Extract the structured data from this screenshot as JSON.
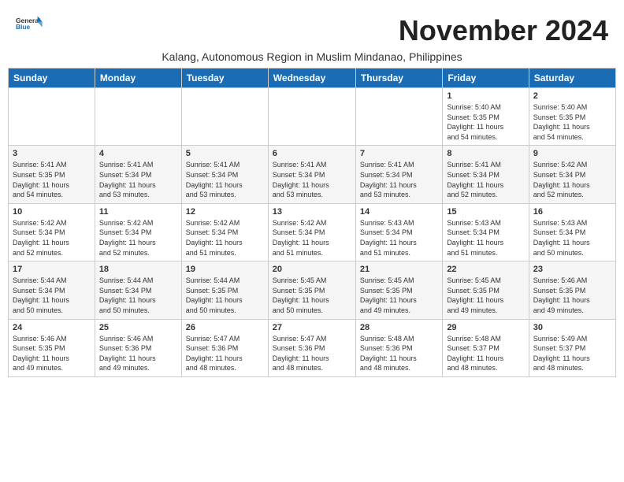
{
  "header": {
    "logo_general": "General",
    "logo_blue": "Blue",
    "month_year": "November 2024",
    "subtitle": "Kalang, Autonomous Region in Muslim Mindanao, Philippines"
  },
  "days_of_week": [
    "Sunday",
    "Monday",
    "Tuesday",
    "Wednesday",
    "Thursday",
    "Friday",
    "Saturday"
  ],
  "weeks": [
    [
      {
        "day": "",
        "info": ""
      },
      {
        "day": "",
        "info": ""
      },
      {
        "day": "",
        "info": ""
      },
      {
        "day": "",
        "info": ""
      },
      {
        "day": "",
        "info": ""
      },
      {
        "day": "1",
        "info": "Sunrise: 5:40 AM\nSunset: 5:35 PM\nDaylight: 11 hours\nand 54 minutes."
      },
      {
        "day": "2",
        "info": "Sunrise: 5:40 AM\nSunset: 5:35 PM\nDaylight: 11 hours\nand 54 minutes."
      }
    ],
    [
      {
        "day": "3",
        "info": "Sunrise: 5:41 AM\nSunset: 5:35 PM\nDaylight: 11 hours\nand 54 minutes."
      },
      {
        "day": "4",
        "info": "Sunrise: 5:41 AM\nSunset: 5:34 PM\nDaylight: 11 hours\nand 53 minutes."
      },
      {
        "day": "5",
        "info": "Sunrise: 5:41 AM\nSunset: 5:34 PM\nDaylight: 11 hours\nand 53 minutes."
      },
      {
        "day": "6",
        "info": "Sunrise: 5:41 AM\nSunset: 5:34 PM\nDaylight: 11 hours\nand 53 minutes."
      },
      {
        "day": "7",
        "info": "Sunrise: 5:41 AM\nSunset: 5:34 PM\nDaylight: 11 hours\nand 53 minutes."
      },
      {
        "day": "8",
        "info": "Sunrise: 5:41 AM\nSunset: 5:34 PM\nDaylight: 11 hours\nand 52 minutes."
      },
      {
        "day": "9",
        "info": "Sunrise: 5:42 AM\nSunset: 5:34 PM\nDaylight: 11 hours\nand 52 minutes."
      }
    ],
    [
      {
        "day": "10",
        "info": "Sunrise: 5:42 AM\nSunset: 5:34 PM\nDaylight: 11 hours\nand 52 minutes."
      },
      {
        "day": "11",
        "info": "Sunrise: 5:42 AM\nSunset: 5:34 PM\nDaylight: 11 hours\nand 52 minutes."
      },
      {
        "day": "12",
        "info": "Sunrise: 5:42 AM\nSunset: 5:34 PM\nDaylight: 11 hours\nand 51 minutes."
      },
      {
        "day": "13",
        "info": "Sunrise: 5:42 AM\nSunset: 5:34 PM\nDaylight: 11 hours\nand 51 minutes."
      },
      {
        "day": "14",
        "info": "Sunrise: 5:43 AM\nSunset: 5:34 PM\nDaylight: 11 hours\nand 51 minutes."
      },
      {
        "day": "15",
        "info": "Sunrise: 5:43 AM\nSunset: 5:34 PM\nDaylight: 11 hours\nand 51 minutes."
      },
      {
        "day": "16",
        "info": "Sunrise: 5:43 AM\nSunset: 5:34 PM\nDaylight: 11 hours\nand 50 minutes."
      }
    ],
    [
      {
        "day": "17",
        "info": "Sunrise: 5:44 AM\nSunset: 5:34 PM\nDaylight: 11 hours\nand 50 minutes."
      },
      {
        "day": "18",
        "info": "Sunrise: 5:44 AM\nSunset: 5:34 PM\nDaylight: 11 hours\nand 50 minutes."
      },
      {
        "day": "19",
        "info": "Sunrise: 5:44 AM\nSunset: 5:35 PM\nDaylight: 11 hours\nand 50 minutes."
      },
      {
        "day": "20",
        "info": "Sunrise: 5:45 AM\nSunset: 5:35 PM\nDaylight: 11 hours\nand 50 minutes."
      },
      {
        "day": "21",
        "info": "Sunrise: 5:45 AM\nSunset: 5:35 PM\nDaylight: 11 hours\nand 49 minutes."
      },
      {
        "day": "22",
        "info": "Sunrise: 5:45 AM\nSunset: 5:35 PM\nDaylight: 11 hours\nand 49 minutes."
      },
      {
        "day": "23",
        "info": "Sunrise: 5:46 AM\nSunset: 5:35 PM\nDaylight: 11 hours\nand 49 minutes."
      }
    ],
    [
      {
        "day": "24",
        "info": "Sunrise: 5:46 AM\nSunset: 5:35 PM\nDaylight: 11 hours\nand 49 minutes."
      },
      {
        "day": "25",
        "info": "Sunrise: 5:46 AM\nSunset: 5:36 PM\nDaylight: 11 hours\nand 49 minutes."
      },
      {
        "day": "26",
        "info": "Sunrise: 5:47 AM\nSunset: 5:36 PM\nDaylight: 11 hours\nand 48 minutes."
      },
      {
        "day": "27",
        "info": "Sunrise: 5:47 AM\nSunset: 5:36 PM\nDaylight: 11 hours\nand 48 minutes."
      },
      {
        "day": "28",
        "info": "Sunrise: 5:48 AM\nSunset: 5:36 PM\nDaylight: 11 hours\nand 48 minutes."
      },
      {
        "day": "29",
        "info": "Sunrise: 5:48 AM\nSunset: 5:37 PM\nDaylight: 11 hours\nand 48 minutes."
      },
      {
        "day": "30",
        "info": "Sunrise: 5:49 AM\nSunset: 5:37 PM\nDaylight: 11 hours\nand 48 minutes."
      }
    ]
  ]
}
